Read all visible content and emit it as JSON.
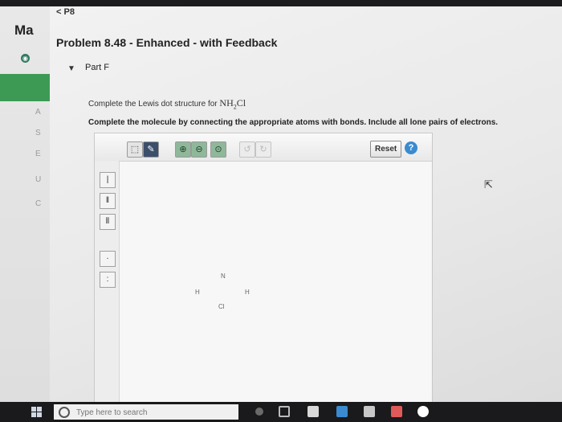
{
  "sidebar": {
    "app_prefix": "Ma",
    "faint_letters": [
      "A",
      "S",
      "E",
      "U",
      "C"
    ]
  },
  "nav": {
    "back_label": "< P8"
  },
  "problem": {
    "title": "Problem 8.48 - Enhanced - with Feedback",
    "part_toggle": "▼",
    "part_label": "Part F",
    "question_prefix": "Complete the Lewis dot structure for ",
    "formula_main": "NH",
    "formula_sub": "2",
    "formula_end": "Cl",
    "instruction": "Complete the molecule by connecting the appropriate atoms with bonds. Include all lone pairs of electrons."
  },
  "editor": {
    "reset_label": "Reset",
    "help_label": "?",
    "toolbar_icons": [
      "selection-icon",
      "pencil-icon",
      "zoom-in-icon",
      "zoom-out-icon",
      "zoom-fit-icon",
      "undo-icon",
      "redo-icon"
    ],
    "side_tools": [
      "single-bond-icon",
      "double-bond-icon",
      "triple-bond-icon",
      "lone-pair-icon",
      "electron-pair-icon"
    ],
    "atoms": [
      {
        "symbol": "N"
      },
      {
        "symbol": "H"
      },
      {
        "symbol": "H"
      },
      {
        "symbol": "Cl"
      }
    ]
  },
  "taskbar": {
    "search_placeholder": "Type here to search"
  },
  "colors": {
    "accent_green": "#3d9a55",
    "help_blue": "#3a8bd0",
    "taskbar": "#1a1a1c"
  }
}
